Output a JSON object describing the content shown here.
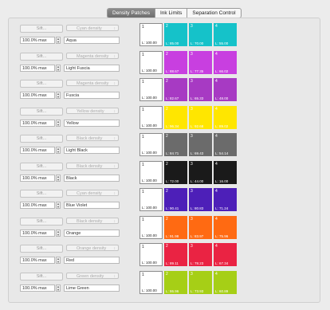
{
  "tabs": [
    {
      "label": "Density Patches",
      "active": true
    },
    {
      "label": "Ink Limits",
      "active": false
    },
    {
      "label": "Separation Control",
      "active": false
    }
  ],
  "rows": [
    {
      "sift": "Sift...",
      "density": "Cyan density",
      "max": "100.0% max",
      "name": "Aqua",
      "color": "#15c2c9",
      "patches": [
        {
          "n": "1",
          "l": "L: 100.00"
        },
        {
          "n": "2",
          "l": "L: 85.00"
        },
        {
          "n": "3",
          "l": "L: 70.00"
        },
        {
          "n": "4",
          "l": "L: 55.00"
        }
      ]
    },
    {
      "sift": "Sift...",
      "density": "Magenta density",
      "max": "100.0% max",
      "name": "Light Fuscia",
      "color": "#c83fe0",
      "patches": [
        {
          "n": "1",
          "l": "L: 100.00"
        },
        {
          "n": "2",
          "l": "L: 88.67"
        },
        {
          "n": "3",
          "l": "L: 77.35"
        },
        {
          "n": "4",
          "l": "L: 66.02"
        }
      ]
    },
    {
      "sift": "Sift...",
      "density": "Magenta density",
      "max": "100.0% max",
      "name": "Fuscia",
      "color": "#a73ac3",
      "patches": [
        {
          "n": "1",
          "l": "L: 100.00"
        },
        {
          "n": "2",
          "l": "L: 82.67"
        },
        {
          "n": "3",
          "l": "L: 65.33"
        },
        {
          "n": "4",
          "l": "L: 48.00"
        }
      ]
    },
    {
      "sift": "Sift...",
      "density": "Yellow density",
      "max": "100.0% max",
      "name": "Yellow",
      "color": "#ffe600",
      "patches": [
        {
          "n": "1",
          "l": "L: 100.00"
        },
        {
          "n": "2",
          "l": "L: 96.34"
        },
        {
          "n": "3",
          "l": "L: 92.68"
        },
        {
          "n": "4",
          "l": "L: 89.02"
        }
      ]
    },
    {
      "sift": "Sift...",
      "density": "Black density",
      "max": "100.0% max",
      "name": "Light Black",
      "color": "#6b6b6b",
      "patches": [
        {
          "n": "1",
          "l": "L: 100.00"
        },
        {
          "n": "2",
          "l": "L: 84.71"
        },
        {
          "n": "3",
          "l": "L: 69.43"
        },
        {
          "n": "4",
          "l": "L: 54.14"
        }
      ]
    },
    {
      "sift": "Sift...",
      "density": "Black density",
      "max": "100.0% max",
      "name": "Black",
      "color": "#1a1a1a",
      "patches": [
        {
          "n": "1",
          "l": "L: 100.00"
        },
        {
          "n": "2",
          "l": "L: 72.00"
        },
        {
          "n": "3",
          "l": "L: 44.00"
        },
        {
          "n": "4",
          "l": "L: 16.00"
        }
      ]
    },
    {
      "sift": "Sift...",
      "density": "Cyan density",
      "max": "100.0% max",
      "name": "Blue Violet",
      "color": "#4d1fb8",
      "patches": [
        {
          "n": "1",
          "l": "L: 100.00"
        },
        {
          "n": "2",
          "l": "L: 90.41"
        },
        {
          "n": "3",
          "l": "L: 80.83"
        },
        {
          "n": "4",
          "l": "L: 71.24"
        }
      ]
    },
    {
      "sift": "Sift...",
      "density": "Black density",
      "max": "100.0% max",
      "name": "Orange",
      "color": "#ff6a12",
      "patches": [
        {
          "n": "1",
          "l": "L: 100.00"
        },
        {
          "n": "2",
          "l": "L: 91.98"
        },
        {
          "n": "3",
          "l": "L: 83.97"
        },
        {
          "n": "4",
          "l": "L: 75.96"
        }
      ]
    },
    {
      "sift": "Sift...",
      "density": "Orange density",
      "max": "100.0% max",
      "name": "Red",
      "color": "#ea2343",
      "patches": [
        {
          "n": "1",
          "l": "L: 100.00"
        },
        {
          "n": "2",
          "l": "L: 89.11"
        },
        {
          "n": "3",
          "l": "L: 78.23"
        },
        {
          "n": "4",
          "l": "L: 67.34"
        }
      ]
    },
    {
      "sift": "Sift...",
      "density": "Green density",
      "max": "100.0% max",
      "name": "Lime Green",
      "color": "#a6cf16",
      "patches": [
        {
          "n": "1",
          "l": "L: 100.00"
        },
        {
          "n": "2",
          "l": "L: 86.96"
        },
        {
          "n": "3",
          "l": "L: 73.93"
        },
        {
          "n": "4",
          "l": "L: 60.89"
        }
      ]
    }
  ]
}
